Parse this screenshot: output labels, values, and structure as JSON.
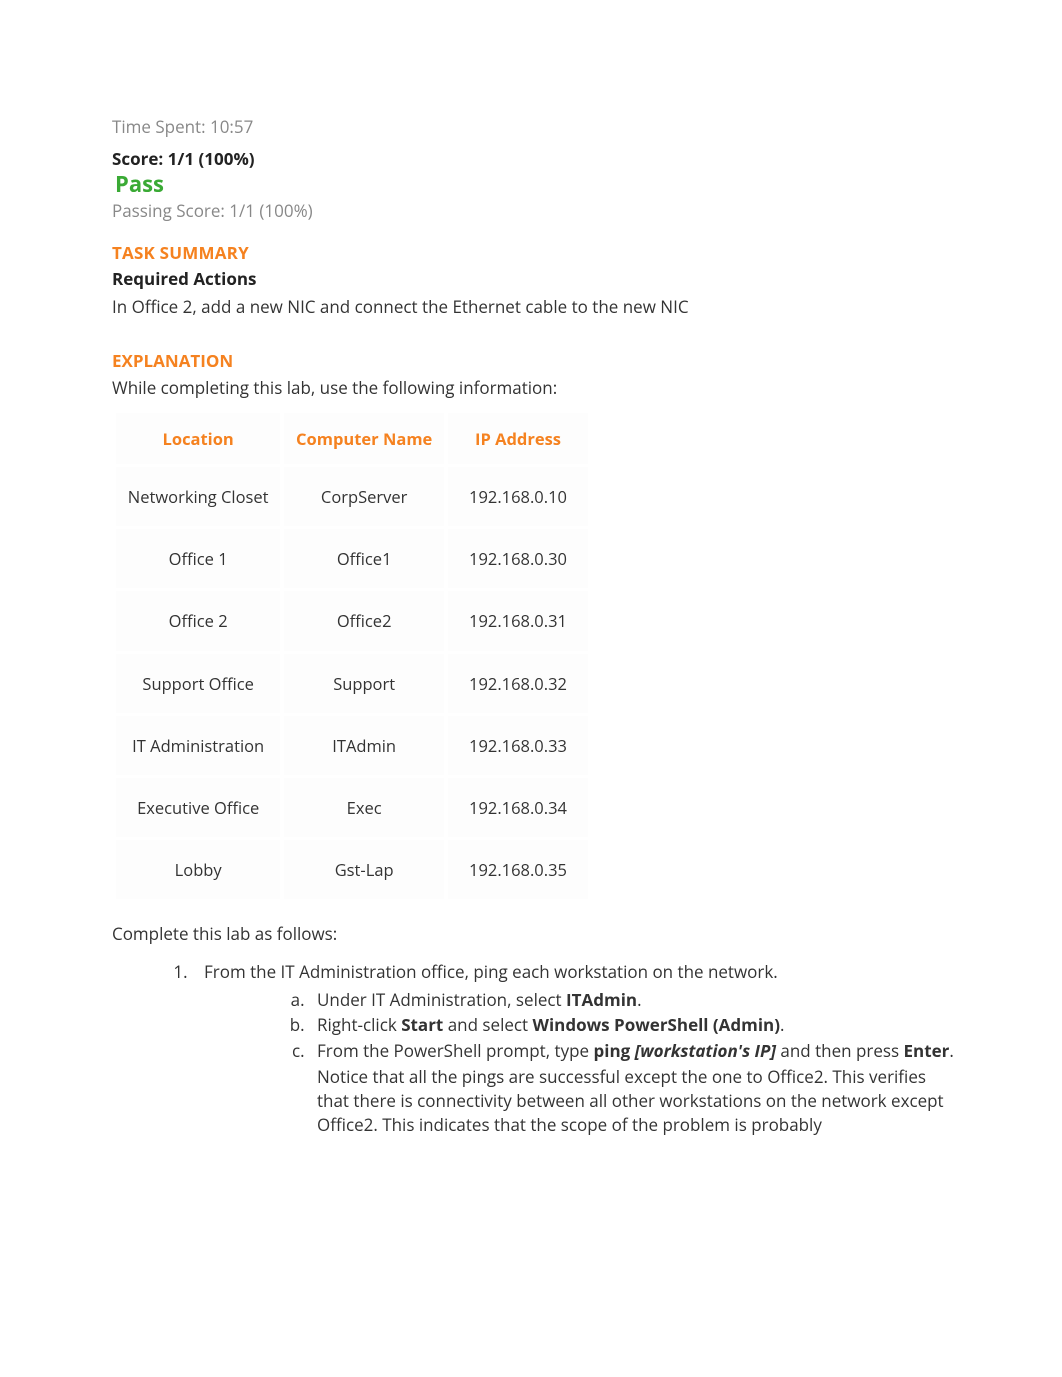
{
  "time_spent_label": "Time Spent: 10:57",
  "score_label": "Score: 1/1 (100%)",
  "pass_label": "Pass",
  "passing_score_label": "Passing Score: 1/1 (100%)",
  "task_summary_head": "TASK SUMMARY",
  "required_actions_head": "Required Actions",
  "required_action_1": "In Office 2, add a new NIC and connect the Ethernet cable to the new NIC",
  "explanation_head": "EXPLANATION",
  "explanation_intro": "While completing this lab, use the following information:",
  "table": {
    "headers": {
      "location": "Location",
      "computer": "Computer Name",
      "ip": "IP Address"
    },
    "rows": [
      {
        "location": "Networking Closet",
        "computer": "CorpServer",
        "ip": "192.168.0.10"
      },
      {
        "location": "Office 1",
        "computer": "Office1",
        "ip": "192.168.0.30"
      },
      {
        "location": "Office 2",
        "computer": "Office2",
        "ip": "192.168.0.31"
      },
      {
        "location": "Support Office",
        "computer": "Support",
        "ip": "192.168.0.32"
      },
      {
        "location": "IT Administration",
        "computer": "ITAdmin",
        "ip": "192.168.0.33"
      },
      {
        "location": "Executive Office",
        "computer": "Exec",
        "ip": "192.168.0.34"
      },
      {
        "location": "Lobby",
        "computer": "Gst-Lap",
        "ip": "192.168.0.35"
      }
    ]
  },
  "complete_lab": "Complete this lab as follows:",
  "step1": {
    "text": "From the IT Administration office, ping each workstation on the network.",
    "a_pre": "Under IT Administration, select ",
    "a_bold": "ITAdmin",
    "a_post": ".",
    "b_pre": "Right-click ",
    "b_bold1": "Start",
    "b_mid": " and select ",
    "b_bold2": "Windows PowerShell (Admin)",
    "b_post": ".",
    "c_pre": "From the PowerShell prompt, type ",
    "c_bold1": "ping ",
    "c_bi": "[workstation's IP]",
    "c_mid": " and then press ",
    "c_bold2": "Enter",
    "c_post": ".",
    "c_note": "Notice that all the pings are successful except the one to Office2. This verifies that there is connectivity between all other workstations on the network except Office2. This indicates that the scope of the problem is probably"
  }
}
